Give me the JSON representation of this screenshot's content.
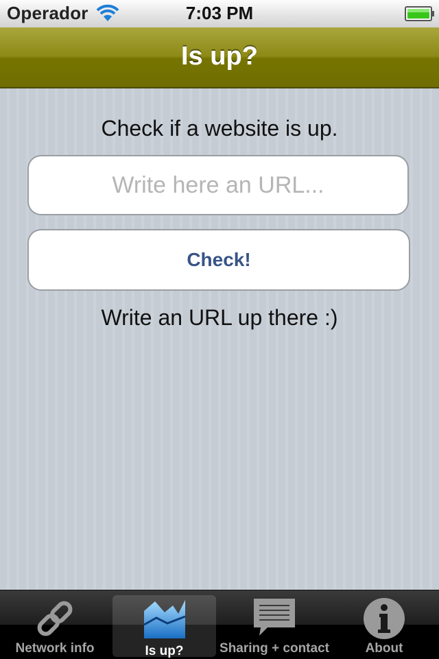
{
  "status_bar": {
    "carrier": "Operador",
    "time": "7:03 PM"
  },
  "nav": {
    "title": "Is up?"
  },
  "main": {
    "heading": "Check if a website is up.",
    "url_placeholder": "Write here an URL...",
    "url_value": "",
    "check_label": "Check!",
    "result_text": "Write an URL up there :)"
  },
  "tabs": [
    {
      "label": "Network info",
      "icon": "chain-link-icon",
      "selected": false
    },
    {
      "label": "Is up?",
      "icon": "area-chart-icon",
      "selected": true
    },
    {
      "label": "Sharing + contact",
      "icon": "speech-bubble-icon",
      "selected": false
    },
    {
      "label": "About",
      "icon": "info-icon",
      "selected": false
    }
  ],
  "colors": {
    "navbar": "#7f7c08",
    "button_text": "#385487",
    "background": "#c5ccd4",
    "selected_icon": "#3aa0e8"
  }
}
